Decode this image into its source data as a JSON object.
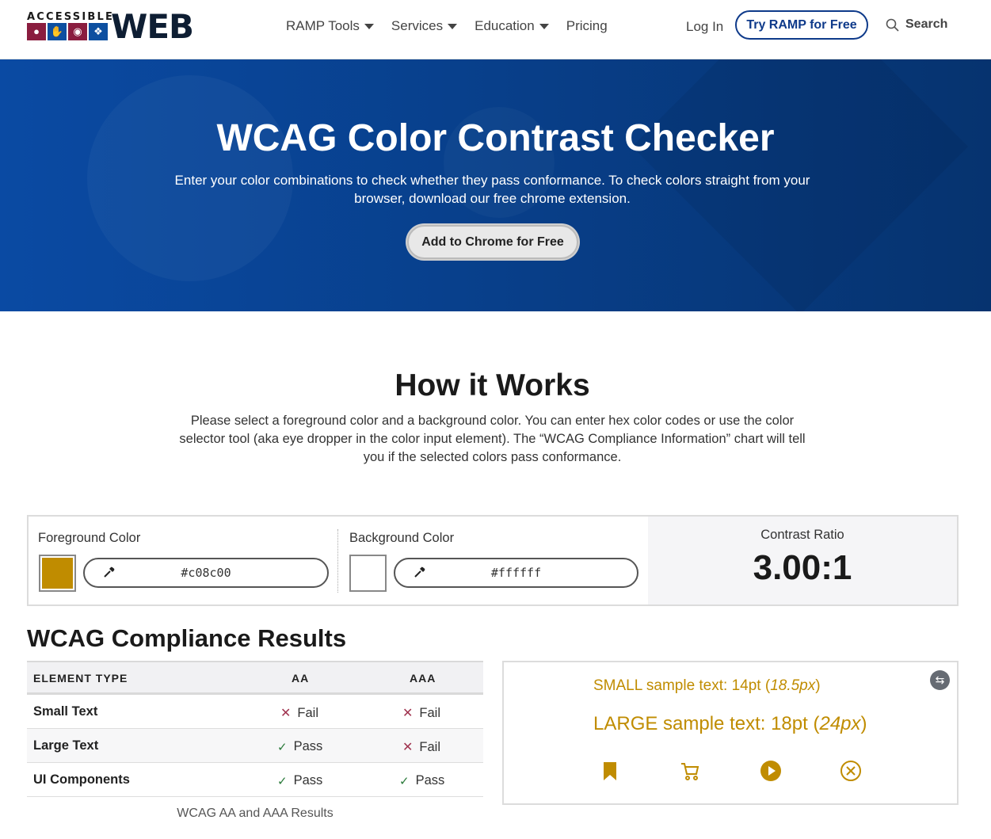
{
  "header": {
    "logo_small": "ACCESSIBLE",
    "logo_big": "WEB",
    "nav": [
      {
        "label": "RAMP Tools",
        "has_caret": true
      },
      {
        "label": "Services",
        "has_caret": true
      },
      {
        "label": "Education",
        "has_caret": true
      },
      {
        "label": "Pricing",
        "has_caret": false
      }
    ],
    "login": "Log In",
    "try_button": "Try RAMP for Free",
    "search": "Search"
  },
  "hero": {
    "title": "WCAG Color Contrast Checker",
    "subtitle": "Enter your color combinations to check whether they pass conformance. To check colors straight from your browser, download our free chrome extension.",
    "button": "Add to Chrome for Free"
  },
  "how": {
    "title": "How it Works",
    "text": "Please select a foreground color and a background color. You can enter hex color codes or use the color selector tool (aka eye dropper in the color input element). The “WCAG Compliance Information” chart will tell you if the selected colors pass conformance."
  },
  "colors": {
    "foreground_label": "Foreground Color",
    "foreground_value": "#c08c00",
    "background_label": "Background Color",
    "background_value": "#ffffff",
    "ratio_label": "Contrast Ratio",
    "ratio_value": "3.00:1",
    "foreground_hex": "#c08c00",
    "background_hex": "#ffffff"
  },
  "compliance": {
    "title": "WCAG Compliance Results",
    "headers": [
      "ELEMENT TYPE",
      "AA",
      "AAA"
    ],
    "rows": [
      {
        "name": "Small Text",
        "aa": "Fail",
        "aaa": "Fail"
      },
      {
        "name": "Large Text",
        "aa": "Pass",
        "aaa": "Fail"
      },
      {
        "name": "UI Components",
        "aa": "Pass",
        "aaa": "Pass"
      }
    ],
    "caption": "WCAG AA and AAA Results"
  },
  "sample": {
    "small_prefix": "SMALL sample text: 14pt (",
    "small_em": "18.5px",
    "small_suffix": ")",
    "large_prefix": "LARGE sample text: 18pt (",
    "large_em": "24px",
    "large_suffix": ")",
    "icons": [
      "bookmark-icon",
      "cart-icon",
      "play-icon",
      "close-circle-icon"
    ]
  },
  "theme": {
    "accent": "#0e3a8a",
    "fail": "#a0334f",
    "pass": "#2a7a3a"
  }
}
